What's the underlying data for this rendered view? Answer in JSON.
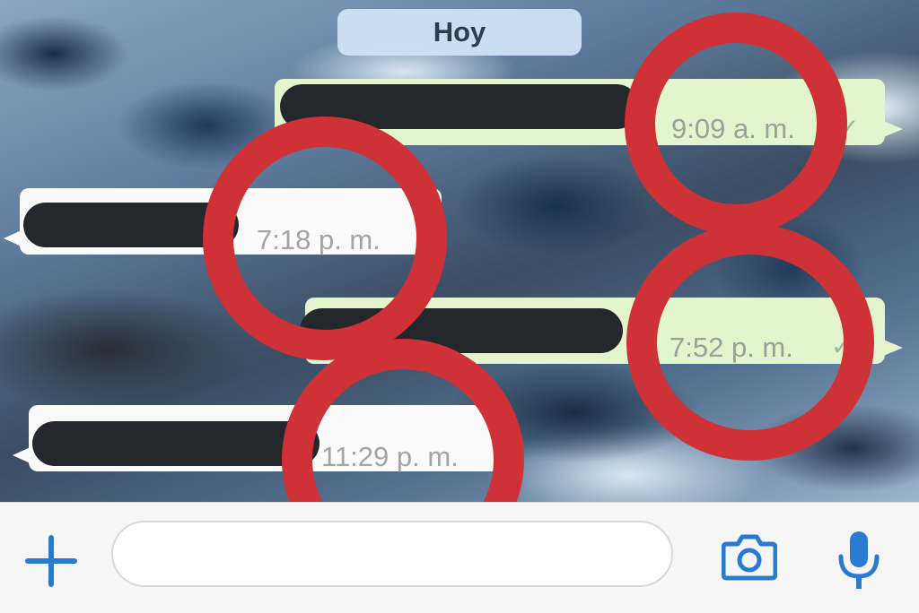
{
  "chat": {
    "date_label": "Hoy",
    "messages": [
      {
        "direction": "outgoing",
        "time": "9:09 a. m.",
        "status": "✓"
      },
      {
        "direction": "incoming",
        "time": "7:18 p. m."
      },
      {
        "direction": "outgoing",
        "time": "7:52 p. m.",
        "status": "✓"
      },
      {
        "direction": "incoming",
        "time": "11:29 p. m."
      }
    ]
  },
  "input_bar": {
    "message_placeholder": "",
    "icons": [
      "plus-icon",
      "camera-icon",
      "microphone-icon"
    ]
  },
  "colors": {
    "accent": "#2a7ad2",
    "outgoing_bubble": "#e3f5cc",
    "incoming_bubble": "#fbfbfb",
    "circle_annotation": "#cf3236",
    "redaction": "#24272b"
  }
}
